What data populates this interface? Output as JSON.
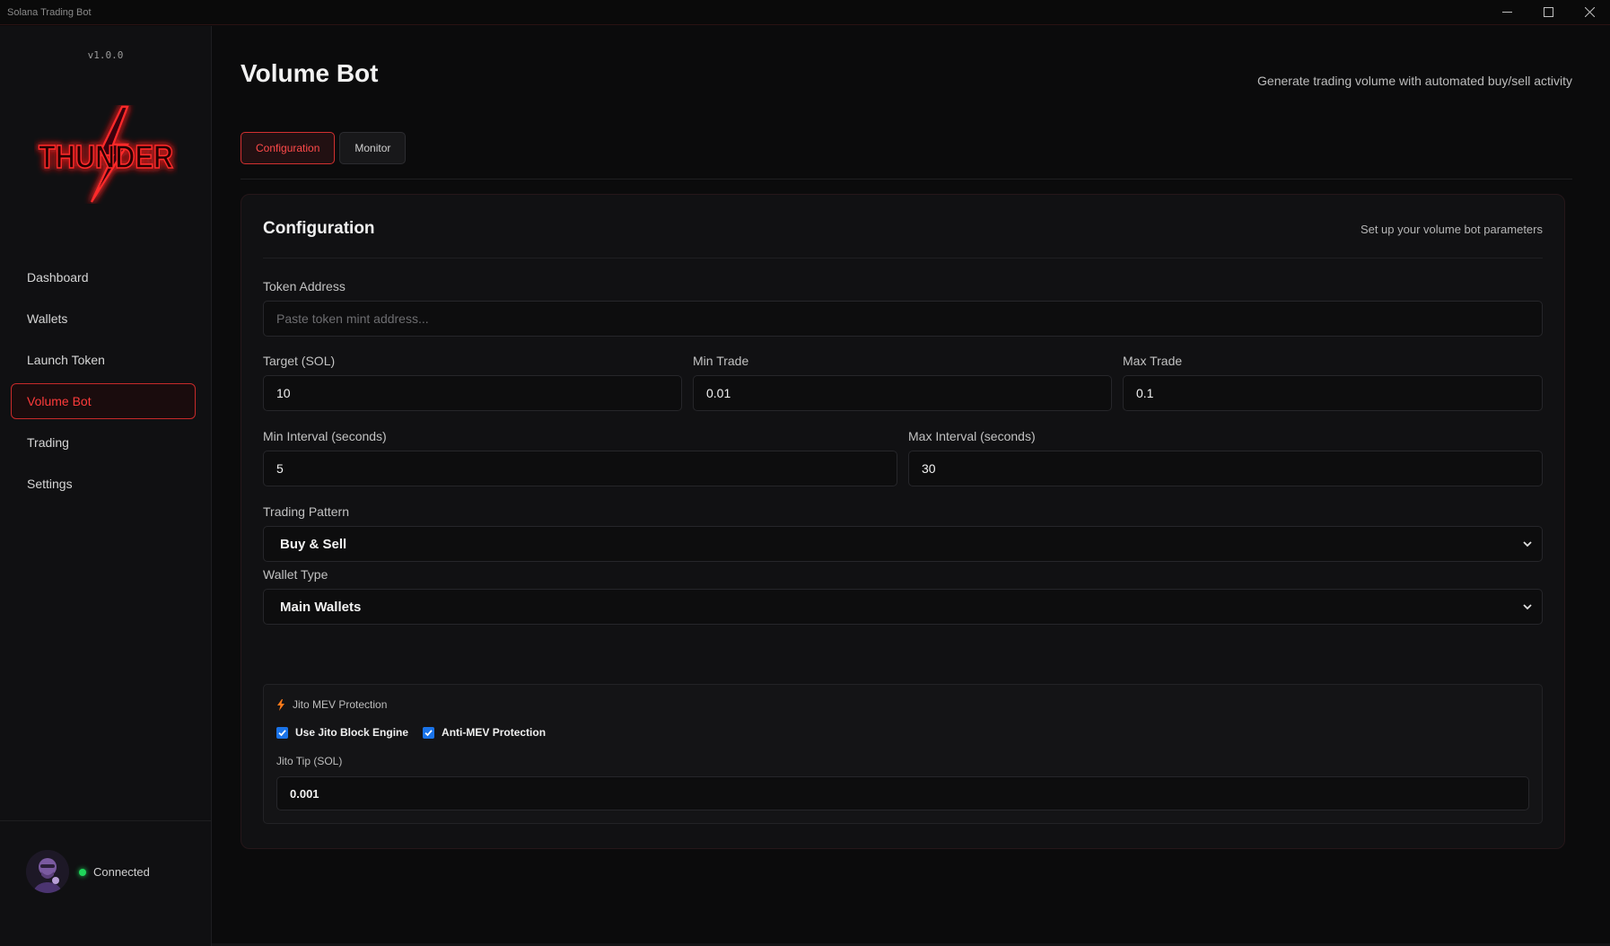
{
  "window": {
    "title": "Solana Trading Bot",
    "controls": [
      "minimize-icon",
      "maximize-icon",
      "close-icon"
    ]
  },
  "sidebar": {
    "version": "v1.0.0",
    "logo_text": "THUNDER",
    "items": [
      {
        "label": "Dashboard",
        "active": false
      },
      {
        "label": "Wallets",
        "active": false
      },
      {
        "label": "Launch Token",
        "active": false
      },
      {
        "label": "Volume Bot",
        "active": true
      },
      {
        "label": "Trading",
        "active": false
      },
      {
        "label": "Settings",
        "active": false
      }
    ],
    "status": {
      "text": "Connected",
      "color": "#1fd65a"
    }
  },
  "header": {
    "title": "Volume Bot",
    "subtitle": "Generate trading volume with automated buy/sell activity"
  },
  "tabs": [
    {
      "label": "Configuration",
      "active": true
    },
    {
      "label": "Monitor",
      "active": false
    }
  ],
  "config": {
    "title": "Configuration",
    "subtitle": "Set up your volume bot parameters",
    "token_address": {
      "label": "Token Address",
      "value": "",
      "placeholder": "Paste token mint address..."
    },
    "target": {
      "label": "Target (SOL)",
      "value": "10"
    },
    "min_trade": {
      "label": "Min Trade",
      "value": "0.01"
    },
    "max_trade": {
      "label": "Max Trade",
      "value": "0.1"
    },
    "min_interval": {
      "label": "Min Interval (seconds)",
      "value": "5"
    },
    "max_interval": {
      "label": "Max Interval (seconds)",
      "value": "30"
    },
    "trading_pattern": {
      "label": "Trading Pattern",
      "value": "Buy & Sell"
    },
    "wallet_type": {
      "label": "Wallet Type",
      "value": "Main Wallets"
    }
  },
  "jito": {
    "title": "Jito MEV Protection",
    "icon": "lightning-icon",
    "use_block_engine": {
      "label": "Use Jito Block Engine",
      "checked": true
    },
    "anti_mev": {
      "label": "Anti-MEV Protection",
      "checked": true
    },
    "tip": {
      "label": "Jito Tip (SOL)",
      "value": "0.001"
    }
  },
  "colors": {
    "accent": "#ff3b3b",
    "accent_border": "#c72a2a",
    "checkbox": "#1a73e8",
    "background": "#0b0b0c"
  }
}
